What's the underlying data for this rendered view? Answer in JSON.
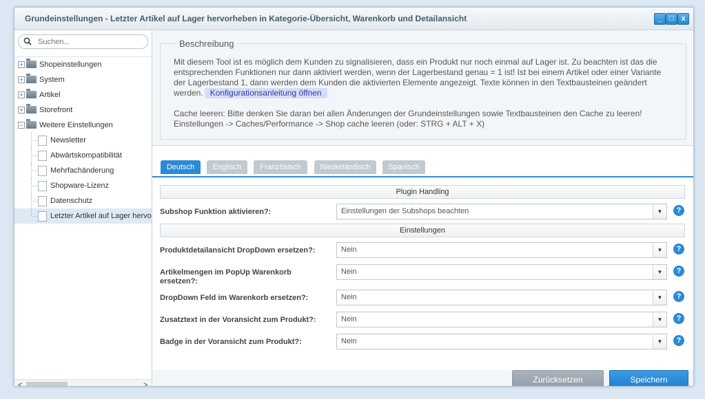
{
  "window": {
    "title": "Grundeinstellungen - Letzter Artikel auf Lager hervorheben in Kategorie-Übersicht, Warenkorb und Detailansicht",
    "controls": {
      "minimize": "_",
      "maximize": "□",
      "close": "x"
    }
  },
  "sidebar": {
    "search_placeholder": "Suchen...",
    "items": [
      {
        "label": "Shopeinstellungen",
        "type": "folder",
        "expander": "+"
      },
      {
        "label": "System",
        "type": "folder",
        "expander": "+"
      },
      {
        "label": "Artikel",
        "type": "folder",
        "expander": "+"
      },
      {
        "label": "Storefront",
        "type": "folder",
        "expander": "+"
      },
      {
        "label": "Weitere Einstellungen",
        "type": "folder",
        "expander": "−"
      }
    ],
    "children": [
      {
        "label": "Newsletter"
      },
      {
        "label": "Abwärtskompatibilität"
      },
      {
        "label": "Mehrfachänderung"
      },
      {
        "label": "Shopware-Lizenz"
      },
      {
        "label": "Datenschutz"
      },
      {
        "label": "Letzter Artikel auf Lager hervo",
        "selected": true
      }
    ],
    "scroll": {
      "left": "<",
      "right": ">"
    }
  },
  "description": {
    "legend": "Beschreibung",
    "text1": "Mit diesem Tool ist es möglich dem Kunden zu signalisieren, dass ein Produkt nur noch einmal auf Lager ist. Zu beachten ist das die entsprechenden Funktionen nur dann aktiviert werden, wenn der Lagerbestand genau = 1 ist! Ist bei einem Artikel oder einer Variante der Lagerbestand 1, dann werden dem Kunden die aktivierten Elemente angezeigt. Texte können in den Textbausteinen geändert werden.",
    "link": "Konfigurationsanleitung öffnen",
    "cache1": "Cache leeren: Bitte denken Sie daran bei allen Änderungen der Grundeinstellungen sowie Textbausteinen den Cache zu leeren!",
    "cache2": "Einstellungen -> Caches/Performance -> Shop cache leeren (oder: STRG + ALT + X)"
  },
  "tabs": [
    {
      "label": "Deutsch",
      "active": true
    },
    {
      "label": "Englisch"
    },
    {
      "label": "Französisch"
    },
    {
      "label": "Niederländisch"
    },
    {
      "label": "Spanisch"
    }
  ],
  "form": {
    "section1": "Plugin Handling",
    "section2": "Einstellungen",
    "fields": [
      {
        "label": "Subshop Funktion aktivieren?:",
        "value": "Einstellungen der Subshops beachten"
      },
      {
        "label": "Produktdetailansicht DropDown ersetzen?:",
        "value": "Nein"
      },
      {
        "label": "Artikelmengen im PopUp Warenkorb ersetzen?:",
        "value": "Nein"
      },
      {
        "label": "DropDown Feld im Warenkorb ersetzen?:",
        "value": "Nein"
      },
      {
        "label": "Zusatztext in der Voransicht zum Produkt?:",
        "value": "Nein"
      },
      {
        "label": "Badge in der Voransicht zum Produkt?:",
        "value": "Nein"
      }
    ],
    "help": "?",
    "trigger": "▼"
  },
  "footer": {
    "reset_label": "Zurücksetzen",
    "save_label": "Speichern"
  },
  "colors": {
    "accent": "#2b8ad6",
    "tab_inactive": "#c1c9d1",
    "link_bg": "#d6ddf8"
  }
}
